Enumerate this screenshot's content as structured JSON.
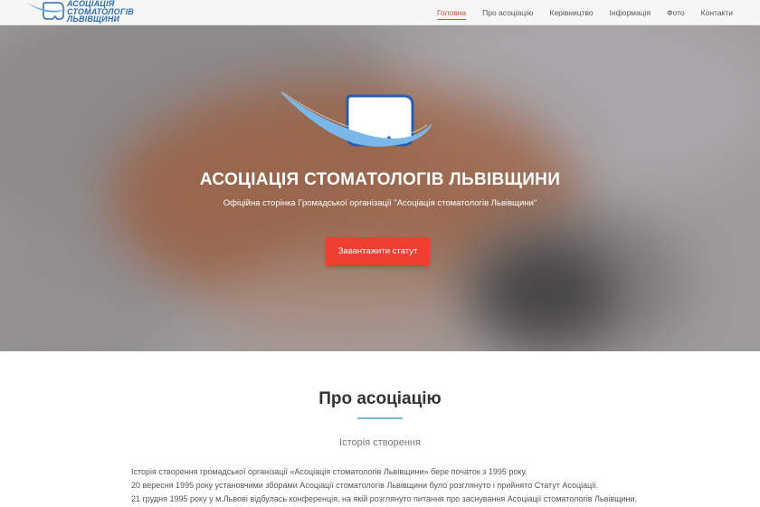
{
  "brand": {
    "logo_lines": [
      "Асоціація",
      "стоматологів",
      "львівщини"
    ],
    "accent": "#f03e31",
    "logo_blue": "#2f6bb3"
  },
  "nav": {
    "items": [
      {
        "label": "Головна",
        "active": true
      },
      {
        "label": "Про асоціацію",
        "active": false
      },
      {
        "label": "Керівництво",
        "active": false
      },
      {
        "label": "Інформація",
        "active": false
      },
      {
        "label": "Фото",
        "active": false
      },
      {
        "label": "Контакти",
        "active": false
      }
    ]
  },
  "hero": {
    "title": "АСОЦІАЦІЯ СТОМАТОЛОГІВ ЛЬВІВЩИНИ",
    "subtitle": "Офіційна сторінка Громадської організації \"Асоціація стоматологів Львівщини\"",
    "button_label": "Завантажити статут"
  },
  "about": {
    "title": "Про асоціацію",
    "subtitle": "Історія створення",
    "paragraphs": [
      "Історія створення громадської організації «Асоціація стоматологів Львівщини» бере початок з 1995 року.",
      "20 вересня 1995 року установчими зборами Асоціації стоматологів Львівщини було розглянуто і прийнято Статут Асоціації.",
      "21 грудня 1995 року у м.Львові відбулась конференція, на якій розглянуто питання про заснування Асоціації стоматологів Львівщини."
    ]
  }
}
